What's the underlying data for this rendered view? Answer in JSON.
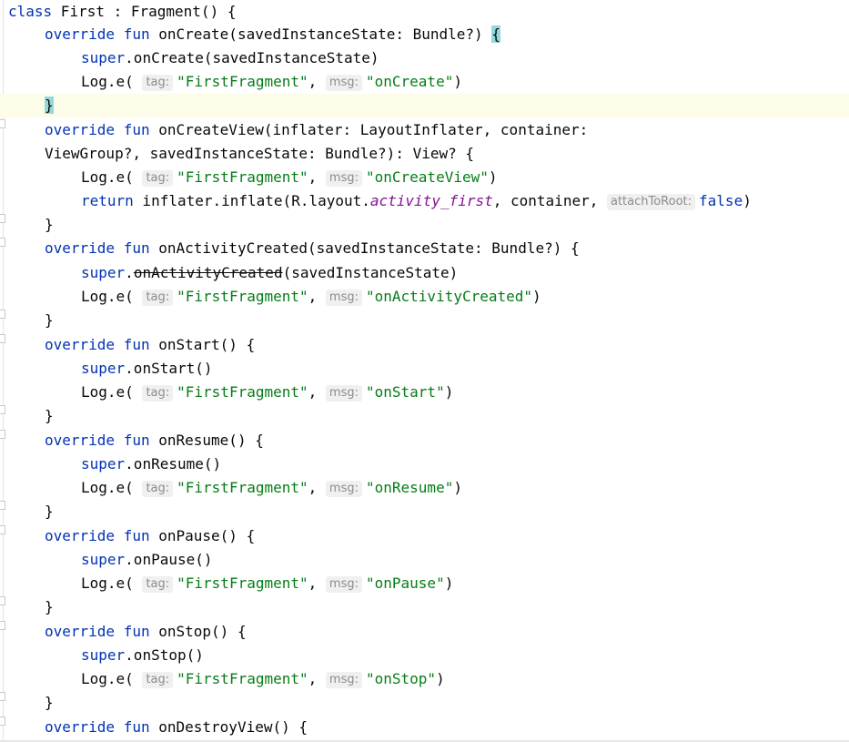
{
  "code": {
    "class_kw": "class",
    "class_decl": " First : Fragment() {",
    "override_kw": "override",
    "fun_kw": "fun",
    "super_kw": "super",
    "return_kw": "return",
    "false_kw": "false",
    "tag_hint": "tag:",
    "msg_hint": "msg:",
    "attach_hint": "attachToRoot:",
    "tag_value": "\"FirstFragment\"",
    "log_open": "Log.e(",
    "comma": ",",
    "close_paren": ")",
    "close_brace": "}",
    "open_brace": "{",
    "onCreate_sig": " onCreate(savedInstanceState: Bundle?) ",
    "onCreate_super": ".onCreate(savedInstanceState)",
    "onCreate_msg": "\"onCreate\"",
    "onCreateView_sig1": " onCreateView(inflater: LayoutInflater, container:",
    "onCreateView_sig2": "ViewGroup?, savedInstanceState: Bundle?): View? {",
    "onCreateView_msg": "\"onCreateView\"",
    "inflate_call": " inflater.inflate(R.layout.",
    "activity_first": "activity_first",
    "inflate_container": ", container, ",
    "onActivityCreated_sig": " onActivityCreated(savedInstanceState: Bundle?) {",
    "super_dot": ".",
    "onActivityCreated_name": "onActivityCreated",
    "onActivityCreated_args": "(savedInstanceState)",
    "onActivityCreated_msg": "\"onActivityCreated\"",
    "onStart_sig": " onStart() {",
    "onStart_super": ".onStart()",
    "onStart_msg": "\"onStart\"",
    "onResume_sig": " onResume() {",
    "onResume_super": ".onResume()",
    "onResume_msg": "\"onResume\"",
    "onPause_sig": " onPause() {",
    "onPause_super": ".onPause()",
    "onPause_msg": "\"onPause\"",
    "onStop_sig": " onStop() {",
    "onStop_super": ".onStop()",
    "onStop_msg": "\"onStop\"",
    "onDestroyView_sig": " onDestroyView() {"
  },
  "colors": {
    "keyword": "#0033b3",
    "string": "#067d17",
    "static_field": "#871094",
    "hint_text": "#8c8c8c",
    "current_line": "#fdfce8",
    "brace_match": "#93d9d9"
  }
}
